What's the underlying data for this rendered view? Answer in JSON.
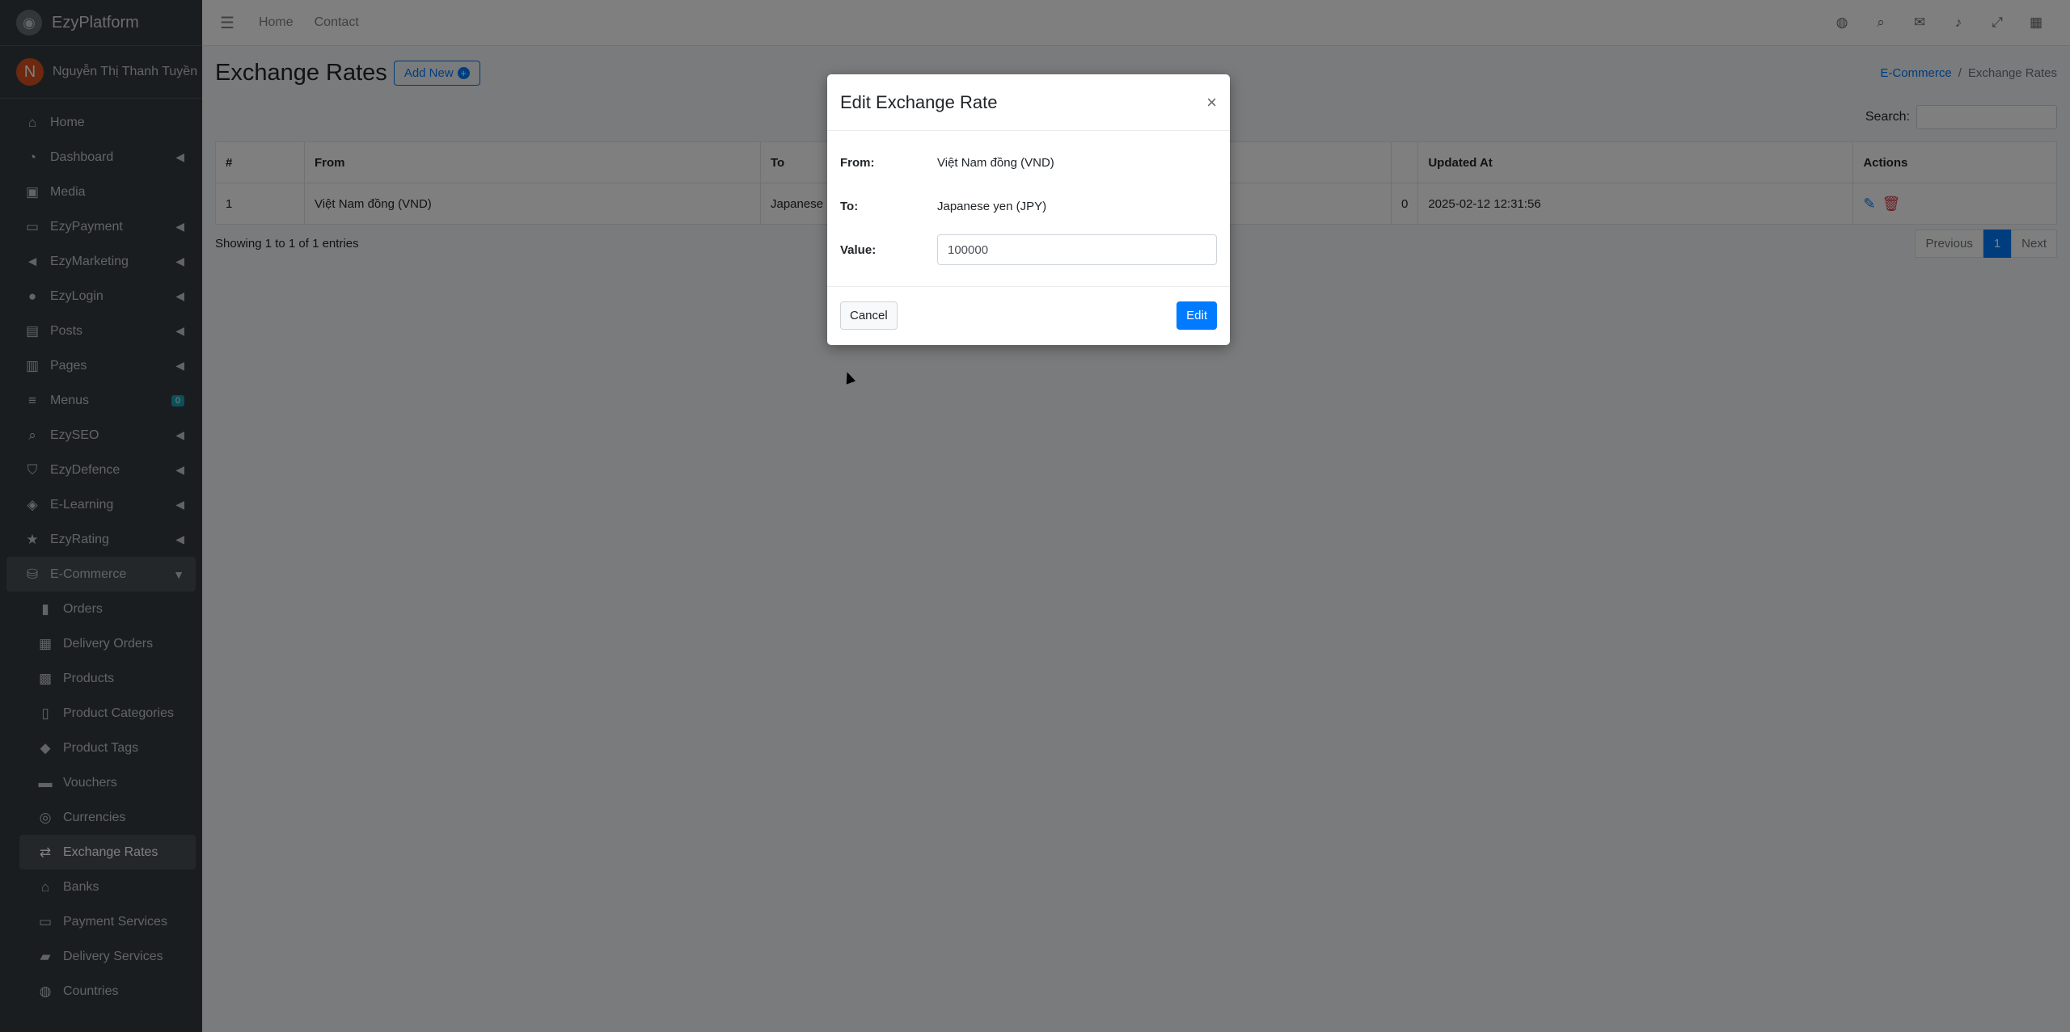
{
  "brand": {
    "name": "EzyPlatform"
  },
  "user": {
    "initial": "N",
    "name": "Nguyễn Thị Thanh Tuyền"
  },
  "sidebar": {
    "items": [
      {
        "label": "Home",
        "icon": "home-icon"
      },
      {
        "label": "Dashboard",
        "icon": "dashboard-icon"
      },
      {
        "label": "Media",
        "icon": "image-icon"
      },
      {
        "label": "EzyPayment",
        "icon": "card-icon"
      },
      {
        "label": "EzyMarketing",
        "icon": "megaphone-icon"
      },
      {
        "label": "EzyLogin",
        "icon": "user-lock-icon"
      },
      {
        "label": "Posts",
        "icon": "posts-icon"
      },
      {
        "label": "Pages",
        "icon": "pages-icon"
      },
      {
        "label": "Menus",
        "icon": "menu-icon",
        "badge": "0"
      },
      {
        "label": "EzySEO",
        "icon": "seo-search-icon"
      },
      {
        "label": "EzyDefence",
        "icon": "shield-icon"
      },
      {
        "label": "E-Learning",
        "icon": "graduation-icon"
      },
      {
        "label": "EzyRating",
        "icon": "star-icon"
      },
      {
        "label": "E-Commerce",
        "icon": "basket-icon"
      }
    ],
    "sub_items": [
      {
        "label": "Orders",
        "icon": "orders-icon"
      },
      {
        "label": "Delivery Orders",
        "icon": "delivery-icon"
      },
      {
        "label": "Products",
        "icon": "products-icon"
      },
      {
        "label": "Product Categories",
        "icon": "clipboard-icon"
      },
      {
        "label": "Product Tags",
        "icon": "tags-icon"
      },
      {
        "label": "Vouchers",
        "icon": "voucher-icon"
      },
      {
        "label": "Currencies",
        "icon": "coins-icon"
      },
      {
        "label": "Exchange Rates",
        "icon": "exchange-icon"
      },
      {
        "label": "Banks",
        "icon": "bank-icon"
      },
      {
        "label": "Payment Services",
        "icon": "payment-icon"
      },
      {
        "label": "Delivery Services",
        "icon": "truck-icon"
      },
      {
        "label": "Countries",
        "icon": "globe-icon"
      }
    ]
  },
  "topbar": {
    "home": "Home",
    "contact": "Contact"
  },
  "page": {
    "title": "Exchange Rates",
    "add_new": "Add New",
    "breadcrumb": {
      "parent": "E-Commerce",
      "current": "Exchange Rates"
    },
    "search_label": "Search:"
  },
  "table": {
    "headers": [
      "#",
      "From",
      "To",
      "",
      "Updated At",
      "Actions"
    ],
    "rows": [
      {
        "id": "1",
        "from": "Việt Nam đồng (VND)",
        "to": "Japanese",
        "value": "0",
        "updated": "2025-02-12 12:31:56"
      }
    ],
    "info": "Showing 1 to 1 of 1 entries",
    "pager": {
      "prev": "Previous",
      "page": "1",
      "next": "Next"
    }
  },
  "modal": {
    "title": "Edit Exchange Rate",
    "close": "×",
    "from_label": "From:",
    "from_value": "Việt Nam đồng (VND)",
    "to_label": "To:",
    "to_value": "Japanese yen (JPY)",
    "value_label": "Value:",
    "value": "100000",
    "cancel": "Cancel",
    "submit": "Edit"
  }
}
